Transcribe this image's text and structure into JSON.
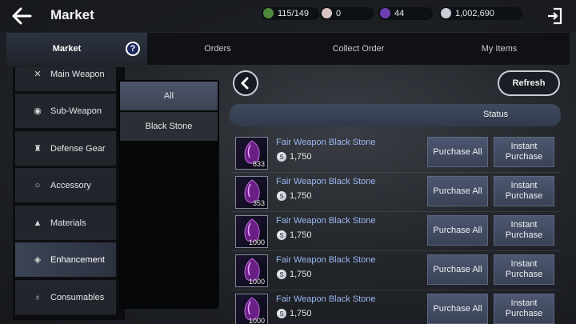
{
  "header": {
    "title": "Market",
    "resources": [
      {
        "name": "weight",
        "value": "115/149",
        "color": "#4f8a3c"
      },
      {
        "name": "pearl",
        "value": "0",
        "color": "#d9c5c0"
      },
      {
        "name": "crystal",
        "value": "44",
        "color": "#6d3fb3"
      },
      {
        "name": "silver",
        "value": "1,002,690",
        "color": "#c8ced8"
      }
    ]
  },
  "tabs": [
    "Market",
    "Orders",
    "Collect Order",
    "My Items"
  ],
  "help": "?",
  "categories": [
    {
      "label": "Main Weapon",
      "icon": "swords-icon"
    },
    {
      "label": "Sub-Weapon",
      "icon": "shield-icon"
    },
    {
      "label": "Defense Gear",
      "icon": "armor-icon"
    },
    {
      "label": "Accessory",
      "icon": "ring-icon"
    },
    {
      "label": "Materials",
      "icon": "flask-icon"
    },
    {
      "label": "Enhancement",
      "icon": "diamond-icon"
    },
    {
      "label": "Consumables",
      "icon": "potion-icon"
    }
  ],
  "subcategories": [
    "All",
    "Black Stone"
  ],
  "refresh": "Refresh",
  "status": "Status",
  "coin_symbol": "S",
  "buttons": {
    "purchase_all": "Purchase All",
    "instant_1": "Instant",
    "instant_2": "Purchase"
  },
  "items": [
    {
      "name": "Fair Weapon Black Stone",
      "price": "1,750",
      "qty": "833"
    },
    {
      "name": "Fair Weapon Black Stone",
      "price": "1,750",
      "qty": "353"
    },
    {
      "name": "Fair Weapon Black Stone",
      "price": "1,750",
      "qty": "1000"
    },
    {
      "name": "Fair Weapon Black Stone",
      "price": "1,750",
      "qty": "1000"
    },
    {
      "name": "Fair Weapon Black Stone",
      "price": "1,750",
      "qty": "1000"
    }
  ]
}
